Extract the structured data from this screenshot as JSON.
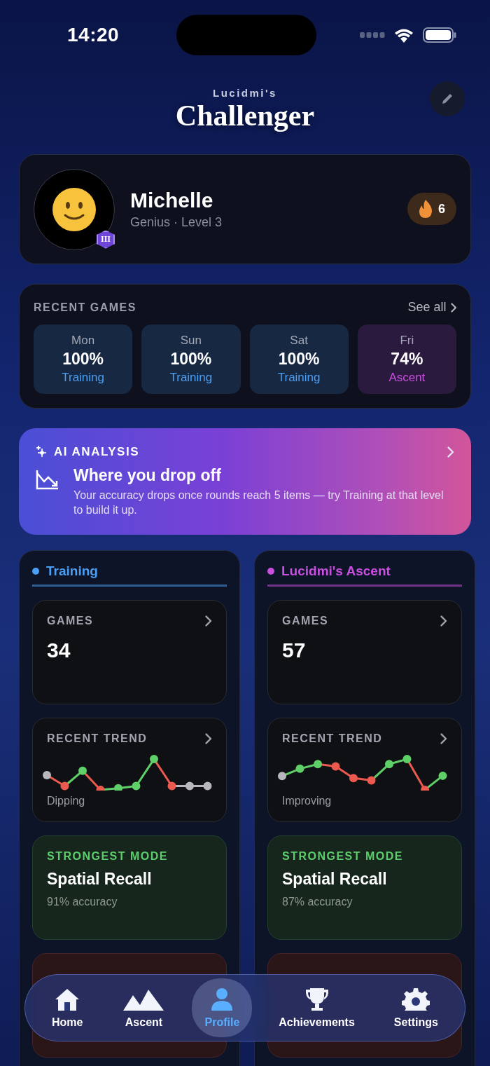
{
  "status_bar": {
    "time": "14:20"
  },
  "header": {
    "kicker": "Lucidmi's",
    "title": "Challenger"
  },
  "profile": {
    "name": "Michelle",
    "subtitle": "Genius · Level 3",
    "rank_badge": "III",
    "streak": "6"
  },
  "recent_games": {
    "title": "RECENT GAMES",
    "see_all": "See all",
    "games": [
      {
        "day": "Mon",
        "score": "100%",
        "mode": "Training",
        "kind": "training"
      },
      {
        "day": "Sun",
        "score": "100%",
        "mode": "Training",
        "kind": "training"
      },
      {
        "day": "Sat",
        "score": "100%",
        "mode": "Training",
        "kind": "training"
      },
      {
        "day": "Fri",
        "score": "74%",
        "mode": "Ascent",
        "kind": "ascent"
      }
    ]
  },
  "ai_analysis": {
    "label": "AI ANALYSIS",
    "title": "Where you drop off",
    "body": "Your accuracy drops once rounds reach 5 items — try Training at that level to build it up."
  },
  "columns": [
    {
      "title": "Training",
      "color": "#4a9ff5",
      "games_label": "GAMES",
      "games": "34",
      "trend_label": "RECENT TREND",
      "trend_caption": "Dipping",
      "strongest_label": "STRONGEST MODE",
      "strongest_name": "Spatial Recall",
      "strongest_detail": "91% accuracy"
    },
    {
      "title": "Lucidmi's Ascent",
      "color": "#c94fe0",
      "games_label": "GAMES",
      "games": "57",
      "trend_label": "RECENT TREND",
      "trend_caption": "Improving",
      "strongest_label": "STRONGEST MODE",
      "strongest_name": "Spatial Recall",
      "strongest_detail": "87% accuracy"
    }
  ],
  "tab_bar": [
    {
      "label": "Home",
      "selected": false
    },
    {
      "label": "Ascent",
      "selected": false
    },
    {
      "label": "Profile",
      "selected": true
    },
    {
      "label": "Achievements",
      "selected": false
    },
    {
      "label": "Settings",
      "selected": false
    }
  ]
}
